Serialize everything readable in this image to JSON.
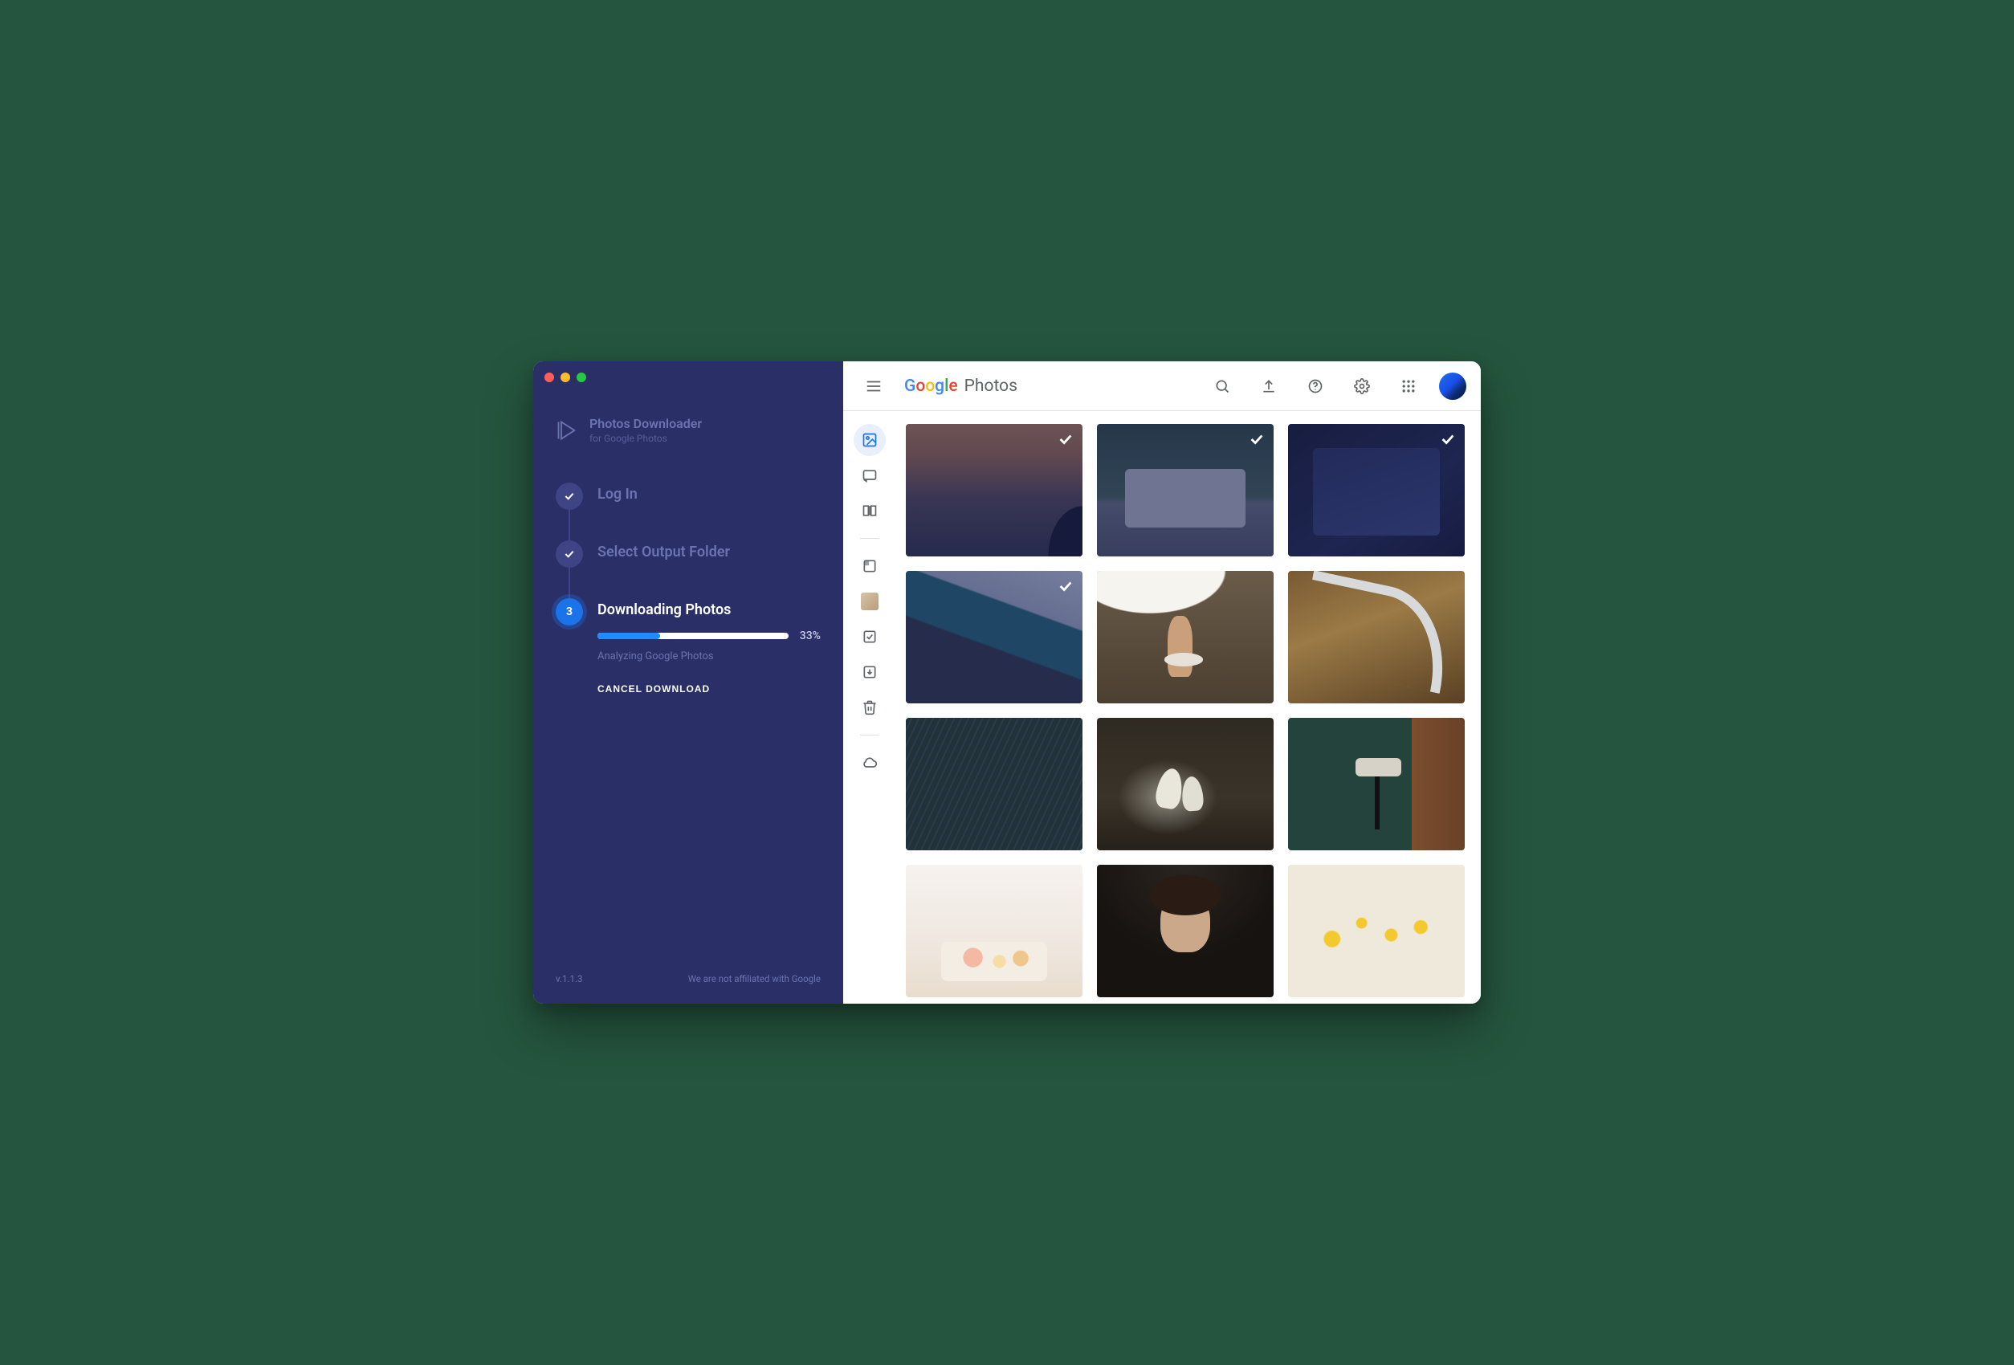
{
  "sidebar": {
    "app_title": "Photos Downloader",
    "app_subtitle": "for Google Photos",
    "steps": [
      {
        "label": "Log In",
        "state": "done"
      },
      {
        "label": "Select Output Folder",
        "state": "done"
      },
      {
        "label": "Downloading Photos",
        "state": "active",
        "badge": "3"
      }
    ],
    "progress": {
      "percent": 33,
      "percent_label": "33%",
      "status": "Analyzing Google Photos"
    },
    "cancel_label": "CANCEL DOWNLOAD",
    "version_label": "v.1.1.3",
    "disclaimer": "We are not affiliated with Google"
  },
  "google_photos": {
    "logo_google": "Google",
    "logo_product": "Photos",
    "topbar_icons": [
      {
        "name": "menu-icon",
        "semantic": "menu"
      },
      {
        "name": "search-icon",
        "semantic": "search"
      },
      {
        "name": "upload-icon",
        "semantic": "upload"
      },
      {
        "name": "help-icon",
        "semantic": "help"
      },
      {
        "name": "gear-icon",
        "semantic": "settings"
      },
      {
        "name": "apps-icon",
        "semantic": "apps-grid"
      }
    ],
    "rail": {
      "group1": [
        "photos",
        "sharing",
        "library"
      ],
      "group2": [
        "albums",
        "people-thumb",
        "favorites",
        "archive",
        "trash"
      ],
      "group3": [
        "cloud"
      ]
    },
    "grid": [
      {
        "selected": true
      },
      {
        "selected": true
      },
      {
        "selected": true
      },
      {
        "selected": true
      },
      {
        "selected": false
      },
      {
        "selected": false
      },
      {
        "selected": false
      },
      {
        "selected": false
      },
      {
        "selected": false
      },
      {
        "selected": false
      },
      {
        "selected": false
      },
      {
        "selected": false
      }
    ]
  }
}
